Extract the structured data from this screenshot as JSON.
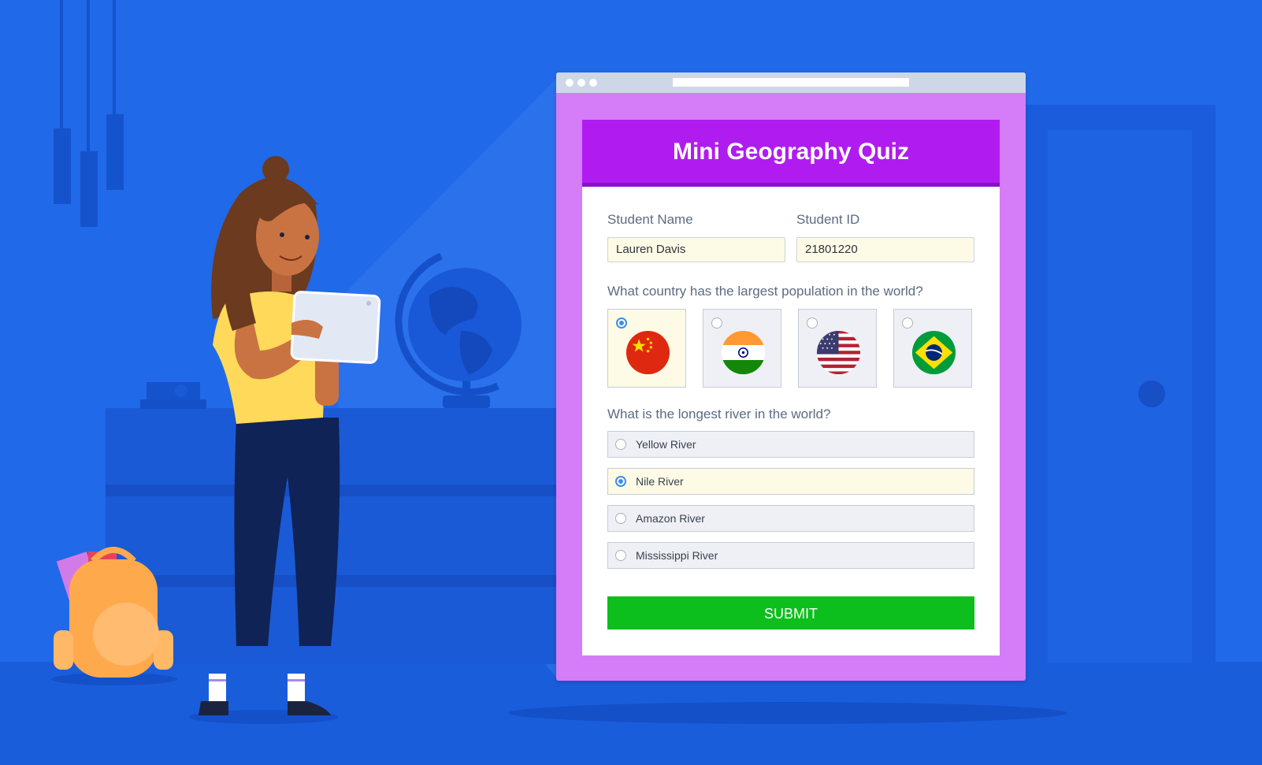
{
  "colors": {
    "background": "#2069e8",
    "browser_frame": "#d57cf8",
    "header": "#b01cf0",
    "submit": "#0cbf1c",
    "selected_fill": "#fdfbe5",
    "radio_accent": "#3b8fe8"
  },
  "quiz": {
    "title": "Mini Geography Quiz",
    "student_name_label": "Student Name",
    "student_name_value": "Lauren Davis",
    "student_id_label": "Student ID",
    "student_id_value": "21801220",
    "q1": {
      "text": "What country has the largest population in the world?",
      "options": [
        {
          "icon": "china-flag-icon",
          "selected": true
        },
        {
          "icon": "india-flag-icon",
          "selected": false
        },
        {
          "icon": "usa-flag-icon",
          "selected": false
        },
        {
          "icon": "brazil-flag-icon",
          "selected": false
        }
      ]
    },
    "q2": {
      "text": "What is the longest river in the world?",
      "options": [
        {
          "label": "Yellow River",
          "selected": false
        },
        {
          "label": "Nile River",
          "selected": true
        },
        {
          "label": "Amazon River",
          "selected": false
        },
        {
          "label": "Mississippi River",
          "selected": false
        }
      ]
    },
    "submit_label": "SUBMIT"
  }
}
